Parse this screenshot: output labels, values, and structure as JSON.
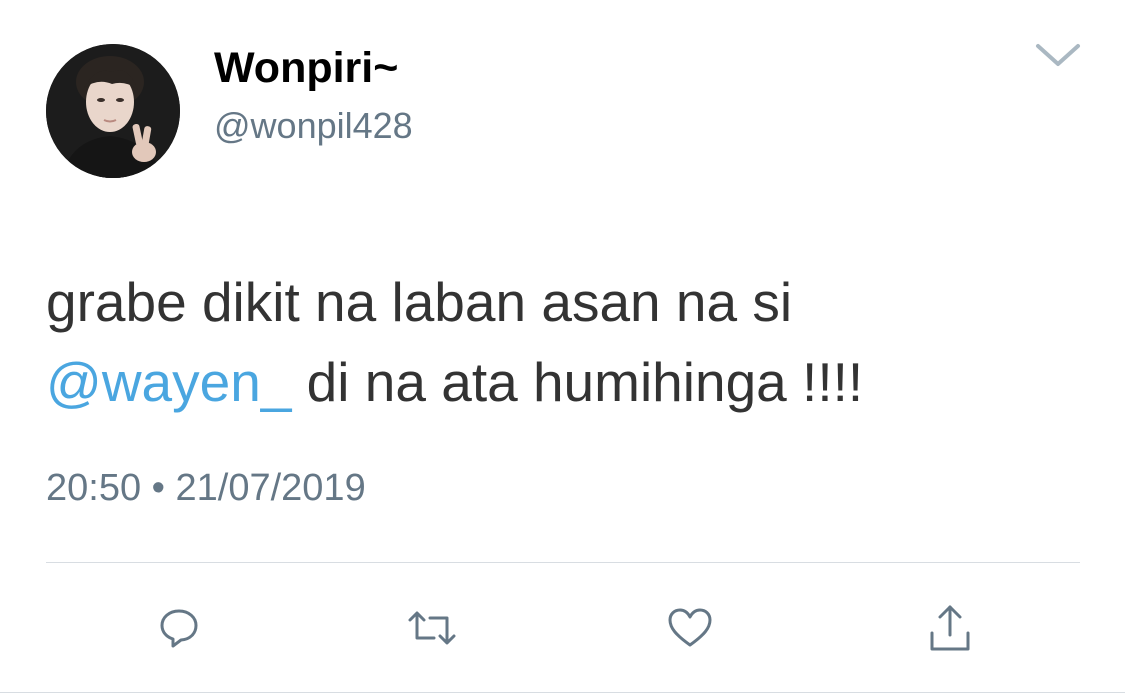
{
  "author": {
    "display_name": "Wonpiri~",
    "handle": "@wonpil428",
    "avatar": "profile-photo"
  },
  "tweet": {
    "text_line1": "grabe dikit na laban asan na si",
    "mention": "@wayen_",
    "text_line2_rest": " di na ata humihinga !!!!",
    "timestamp": "20:50 • 21/07/2019"
  },
  "actions": {
    "reply_icon": "speech-bubble",
    "retweet_icon": "retweet-arrows",
    "like_icon": "heart",
    "share_icon": "share-upload"
  },
  "colors": {
    "mention": "#4aa6e0",
    "secondary_text": "#657786",
    "icon": "#657786",
    "divider": "#d8dde2"
  }
}
